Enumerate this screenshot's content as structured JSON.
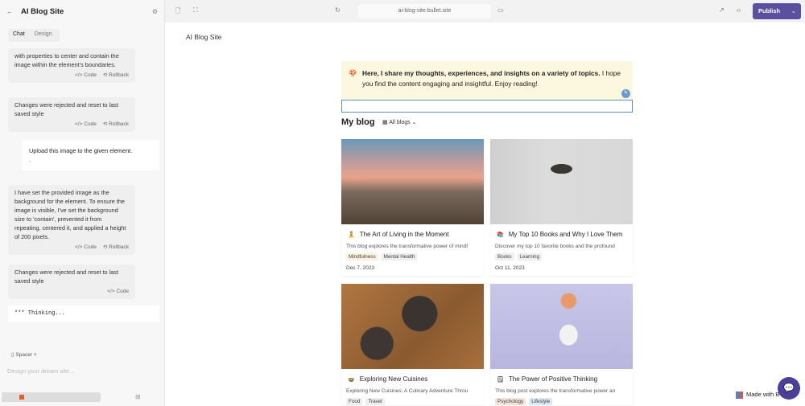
{
  "sidebar": {
    "title": "AI Blog Site",
    "tabs": [
      "Chat",
      "Design"
    ],
    "messages": [
      {
        "text": "with properties to center and contain the image within the element's boundaries.",
        "code": "</> Code",
        "rollback": "⟲ Rollback"
      },
      {
        "text": "Changes were rejected and reset to last saved style",
        "code": "</> Code",
        "rollback": "⟲ Rollback"
      },
      {
        "text": "I have set the provided image as the background for the element. To ensure the image is visible, I've set the background size to 'contain', prevented it from repeating, centered it, and applied a height of 200 pixels.",
        "code": "</> Code",
        "rollback": "⟲ Rollback"
      },
      {
        "text": "Changes were rejected and reset to last saved style",
        "code": "</> Code"
      }
    ],
    "user_message": "Upload this image to the given element.\n.",
    "thinking": "*** Thinking...",
    "chip": "Spacer",
    "input_placeholder": "Design your dream site..."
  },
  "topbar": {
    "url": "ai-blog-site.bullet.site",
    "publish": "Publish"
  },
  "site": {
    "name": "AI Blog Site",
    "intro_bold": "Here, I share my thoughts, experiences, and insights on a variety of topics.",
    "intro_rest": " I hope you find the content engaging and insightful. Enjoy reading!",
    "my_blog": "My blog",
    "all_blogs": "All blogs",
    "posts": [
      {
        "title": "The Art of Living in the Moment",
        "desc": "This blog explores the transformative power of mindf",
        "tags": [
          "Mindfulness",
          "Mental Health"
        ],
        "date": "Dec 7, 2023"
      },
      {
        "title": "My Top 10 Books and Why I Love Them",
        "desc": "Discover my top 10 favorite books and the profound",
        "tags": [
          "Books",
          "Learning"
        ],
        "date": "Oct 11, 2023"
      },
      {
        "title": "Exploring New Cuisines",
        "desc": "Exploring New Cuisines: A Culinary Adventure Throu",
        "tags": [
          "Food",
          "Travel"
        ]
      },
      {
        "title": "The Power of Positive Thinking",
        "desc": "This blog post explores the transformative power an",
        "tags": [
          "Psychology",
          "Lifestyle"
        ]
      }
    ],
    "made_with": "Made with B"
  }
}
